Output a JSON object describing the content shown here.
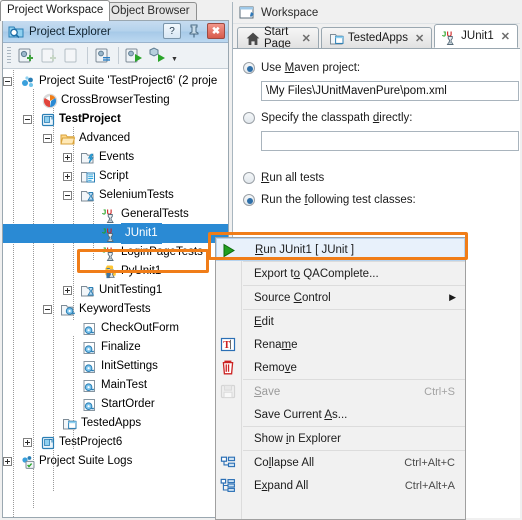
{
  "outer_tabs": [
    {
      "label": "Project Workspace",
      "active": true
    },
    {
      "label": "Object Browser",
      "active": false
    }
  ],
  "project_explorer": {
    "title": "Project Explorer",
    "title_icon": "project-explorer-icon",
    "buttons": [
      {
        "name": "help-button",
        "glyph": "?"
      },
      {
        "name": "pin-button",
        "glyph": "pin-icon"
      },
      {
        "name": "close-button",
        "glyph": "✖"
      }
    ],
    "toolbar": [
      {
        "name": "new-project-suite-icon"
      },
      {
        "name": "new-project-icon"
      },
      {
        "name": "new-item-icon"
      },
      {
        "name": "edit-properties-icon"
      },
      {
        "name": "run-project-icon"
      },
      {
        "name": "run-test-icon"
      },
      {
        "name": "dropdown-arrow-icon"
      }
    ],
    "tree": [
      {
        "label": "Project Suite 'TestProject6' (2 proje",
        "depth": 0,
        "expander": "minus",
        "icon": "project-suite-icon",
        "bold": false
      },
      {
        "label": "CrossBrowserTesting",
        "depth": 1,
        "expander": "none",
        "icon": "cross-browser-testing-icon",
        "bold": false
      },
      {
        "label": "TestProject",
        "depth": 1,
        "expander": "minus",
        "icon": "project-icon",
        "bold": true
      },
      {
        "label": "Advanced",
        "depth": 2,
        "expander": "minus",
        "icon": "folder-open-icon",
        "bold": false
      },
      {
        "label": "Events",
        "depth": 3,
        "expander": "plus",
        "icon": "events-icon",
        "bold": false
      },
      {
        "label": "Script",
        "depth": 3,
        "expander": "plus",
        "icon": "script-icon",
        "bold": false
      },
      {
        "label": "SeleniumTests",
        "depth": 3,
        "expander": "minus",
        "icon": "selenium-tests-icon",
        "bold": false
      },
      {
        "label": "GeneralTests",
        "depth": 4,
        "expander": "none",
        "icon": "junit-icon",
        "bold": false
      },
      {
        "label": "JUnit1",
        "depth": 4,
        "expander": "none",
        "icon": "junit-icon",
        "bold": false,
        "selected": true
      },
      {
        "label": "LoginPageTests",
        "depth": 4,
        "expander": "none",
        "icon": "junit-icon",
        "bold": false
      },
      {
        "label": "PyUnit1",
        "depth": 4,
        "expander": "none",
        "icon": "pyunit-icon",
        "bold": false
      },
      {
        "label": "UnitTesting1",
        "depth": 3,
        "expander": "plus",
        "icon": "selenium-tests-icon",
        "bold": false
      },
      {
        "label": "KeywordTests",
        "depth": 2,
        "expander": "minus",
        "icon": "keyword-tests-icon",
        "bold": false
      },
      {
        "label": "CheckOutForm",
        "depth": 3,
        "expander": "none",
        "icon": "keyword-test-icon",
        "bold": false
      },
      {
        "label": "Finalize",
        "depth": 3,
        "expander": "none",
        "icon": "keyword-test-icon",
        "bold": false
      },
      {
        "label": "InitSettings",
        "depth": 3,
        "expander": "none",
        "icon": "keyword-test-icon",
        "bold": false
      },
      {
        "label": "MainTest",
        "depth": 3,
        "expander": "none",
        "icon": "keyword-test-icon",
        "bold": false
      },
      {
        "label": "StartOrder",
        "depth": 3,
        "expander": "none",
        "icon": "keyword-test-icon",
        "bold": false
      },
      {
        "label": "TestedApps",
        "depth": 2,
        "expander": "none",
        "icon": "tested-apps-icon",
        "bold": false
      },
      {
        "label": "TestProject6",
        "depth": 1,
        "expander": "plus",
        "icon": "project-icon",
        "bold": false
      },
      {
        "label": "Project Suite Logs",
        "depth": 0,
        "expander": "plus",
        "icon": "logs-icon",
        "bold": false
      }
    ]
  },
  "workspace": {
    "title": "Workspace",
    "title_icon": "workspace-icon",
    "tabs": [
      {
        "label": "Start Page",
        "icon": "home-icon",
        "active": false,
        "close": "✕"
      },
      {
        "label": "TestedApps",
        "icon": "tested-apps-icon",
        "active": false,
        "close": "✕"
      },
      {
        "label": "JUnit1",
        "icon": "junit-icon",
        "active": true,
        "close": "✕"
      }
    ],
    "options": {
      "use_maven": {
        "label_pre": "Use ",
        "label_key": "M",
        "label_post": "aven project:",
        "checked": true
      },
      "maven_path_value": "\\My Files\\JUnitMavenPure\\pom.xml",
      "specify_classpath": {
        "label_pre": "Specify the classpath ",
        "label_key": "d",
        "label_post": "irectly:",
        "checked": false
      },
      "classpath_value": "",
      "run_all_tests": {
        "label_pre": "",
        "label_key": "R",
        "label_post": "un all tests",
        "checked": false
      },
      "run_following": {
        "label_pre": "Run the ",
        "label_key": "f",
        "label_post": "ollowing test classes:",
        "checked": true
      }
    }
  },
  "context_menu": {
    "items": [
      {
        "type": "item",
        "label_pre": "",
        "label_key": "R",
        "label_post": "un JUnit1  [ JUnit ]",
        "icon": "run-green-arrow-icon",
        "accel": "",
        "highlight": true,
        "disabled": false
      },
      {
        "type": "sep"
      },
      {
        "type": "item",
        "label_pre": "Export t",
        "label_key": "o",
        "label_post": " QAComplete...",
        "icon": "",
        "accel": "",
        "highlight": false,
        "disabled": false
      },
      {
        "type": "sep"
      },
      {
        "type": "item",
        "label_pre": "Source ",
        "label_key": "C",
        "label_post": "ontrol",
        "icon": "",
        "accel": "",
        "submenu": true,
        "highlight": false,
        "disabled": false
      },
      {
        "type": "sep"
      },
      {
        "type": "item",
        "label_pre": "",
        "label_key": "E",
        "label_post": "dit",
        "icon": "",
        "accel": "",
        "highlight": false,
        "disabled": false
      },
      {
        "type": "item",
        "label_pre": "Rena",
        "label_key": "m",
        "label_post": "e",
        "icon": "rename-icon",
        "accel": "",
        "highlight": false,
        "disabled": false
      },
      {
        "type": "item",
        "label_pre": "Remo",
        "label_key": "v",
        "label_post": "e",
        "icon": "remove-trash-icon",
        "accel": "",
        "highlight": false,
        "disabled": false
      },
      {
        "type": "sep"
      },
      {
        "type": "item",
        "label_pre": "",
        "label_key": "S",
        "label_post": "ave",
        "icon": "save-disk-icon",
        "accel": "Ctrl+S",
        "highlight": false,
        "disabled": true
      },
      {
        "type": "item",
        "label_pre": "Save Current ",
        "label_key": "A",
        "label_post": "s...",
        "icon": "",
        "accel": "",
        "highlight": false,
        "disabled": false
      },
      {
        "type": "sep"
      },
      {
        "type": "item",
        "label_pre": "Show ",
        "label_key": "i",
        "label_post": "n Explorer",
        "icon": "",
        "accel": "",
        "highlight": false,
        "disabled": false
      },
      {
        "type": "sep"
      },
      {
        "type": "item",
        "label_pre": "Co",
        "label_key": "l",
        "label_post": "lapse All",
        "icon": "collapse-all-icon",
        "accel": "Ctrl+Alt+C",
        "highlight": false,
        "disabled": false
      },
      {
        "type": "item",
        "label_pre": "E",
        "label_key": "x",
        "label_post": "pand All",
        "icon": "expand-all-icon",
        "accel": "Ctrl+Alt+A",
        "highlight": false,
        "disabled": false
      }
    ]
  },
  "colors": {
    "highlight_box": "#f07d18",
    "selection_blue": "#2a8ad4",
    "run_arrow_green": "#21a021",
    "panel_title_blue": "#b4d2ec"
  }
}
